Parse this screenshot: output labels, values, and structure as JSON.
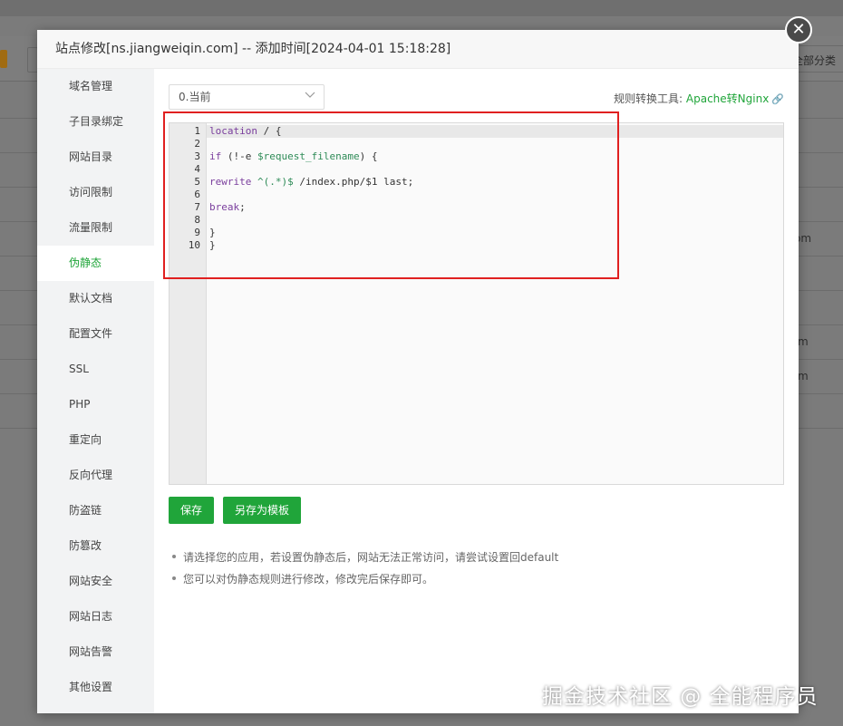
{
  "dialog": {
    "title": "站点修改[ns.jiangweiqin.com] -- 添加时间[2024-04-01 15:18:28]"
  },
  "background": {
    "all_categories": "全部分类",
    "right_texts": [
      "om",
      "m",
      "m"
    ]
  },
  "sidebar": {
    "items": [
      {
        "label": "域名管理",
        "active": false
      },
      {
        "label": "子目录绑定",
        "active": false
      },
      {
        "label": "网站目录",
        "active": false
      },
      {
        "label": "访问限制",
        "active": false
      },
      {
        "label": "流量限制",
        "active": false
      },
      {
        "label": "伪静态",
        "active": true
      },
      {
        "label": "默认文档",
        "active": false
      },
      {
        "label": "配置文件",
        "active": false
      },
      {
        "label": "SSL",
        "active": false
      },
      {
        "label": "PHP",
        "active": false
      },
      {
        "label": "重定向",
        "active": false
      },
      {
        "label": "反向代理",
        "active": false
      },
      {
        "label": "防盗链",
        "active": false
      },
      {
        "label": "防篡改",
        "active": false
      },
      {
        "label": "网站安全",
        "active": false
      },
      {
        "label": "网站日志",
        "active": false
      },
      {
        "label": "网站告警",
        "active": false
      },
      {
        "label": "其他设置",
        "active": false
      }
    ]
  },
  "rewrite": {
    "template_select": "0.当前",
    "tool_label": "规则转换工具: ",
    "tool_link": "Apache转Nginx",
    "code_lines": [
      "location / {",
      "",
      "if (!-e $request_filename) {",
      "",
      "rewrite ^(.*)$ /index.php/$1 last;",
      "",
      "break;",
      "",
      "}",
      "}"
    ],
    "line_numbers": [
      "1",
      "2",
      "3",
      "4",
      "5",
      "6",
      "7",
      "8",
      "9",
      "10"
    ],
    "save_label": "保存",
    "save_as_template_label": "另存为模板",
    "tips": [
      "请选择您的应用，若设置伪静态后，网站无法正常访问，请尝试设置回default",
      "您可以对伪静态规则进行修改，修改完后保存即可。"
    ]
  },
  "watermark": "掘金技术社区 @ 全能程序员",
  "colors": {
    "accent": "#20a53a",
    "highlight": "#e02020"
  }
}
